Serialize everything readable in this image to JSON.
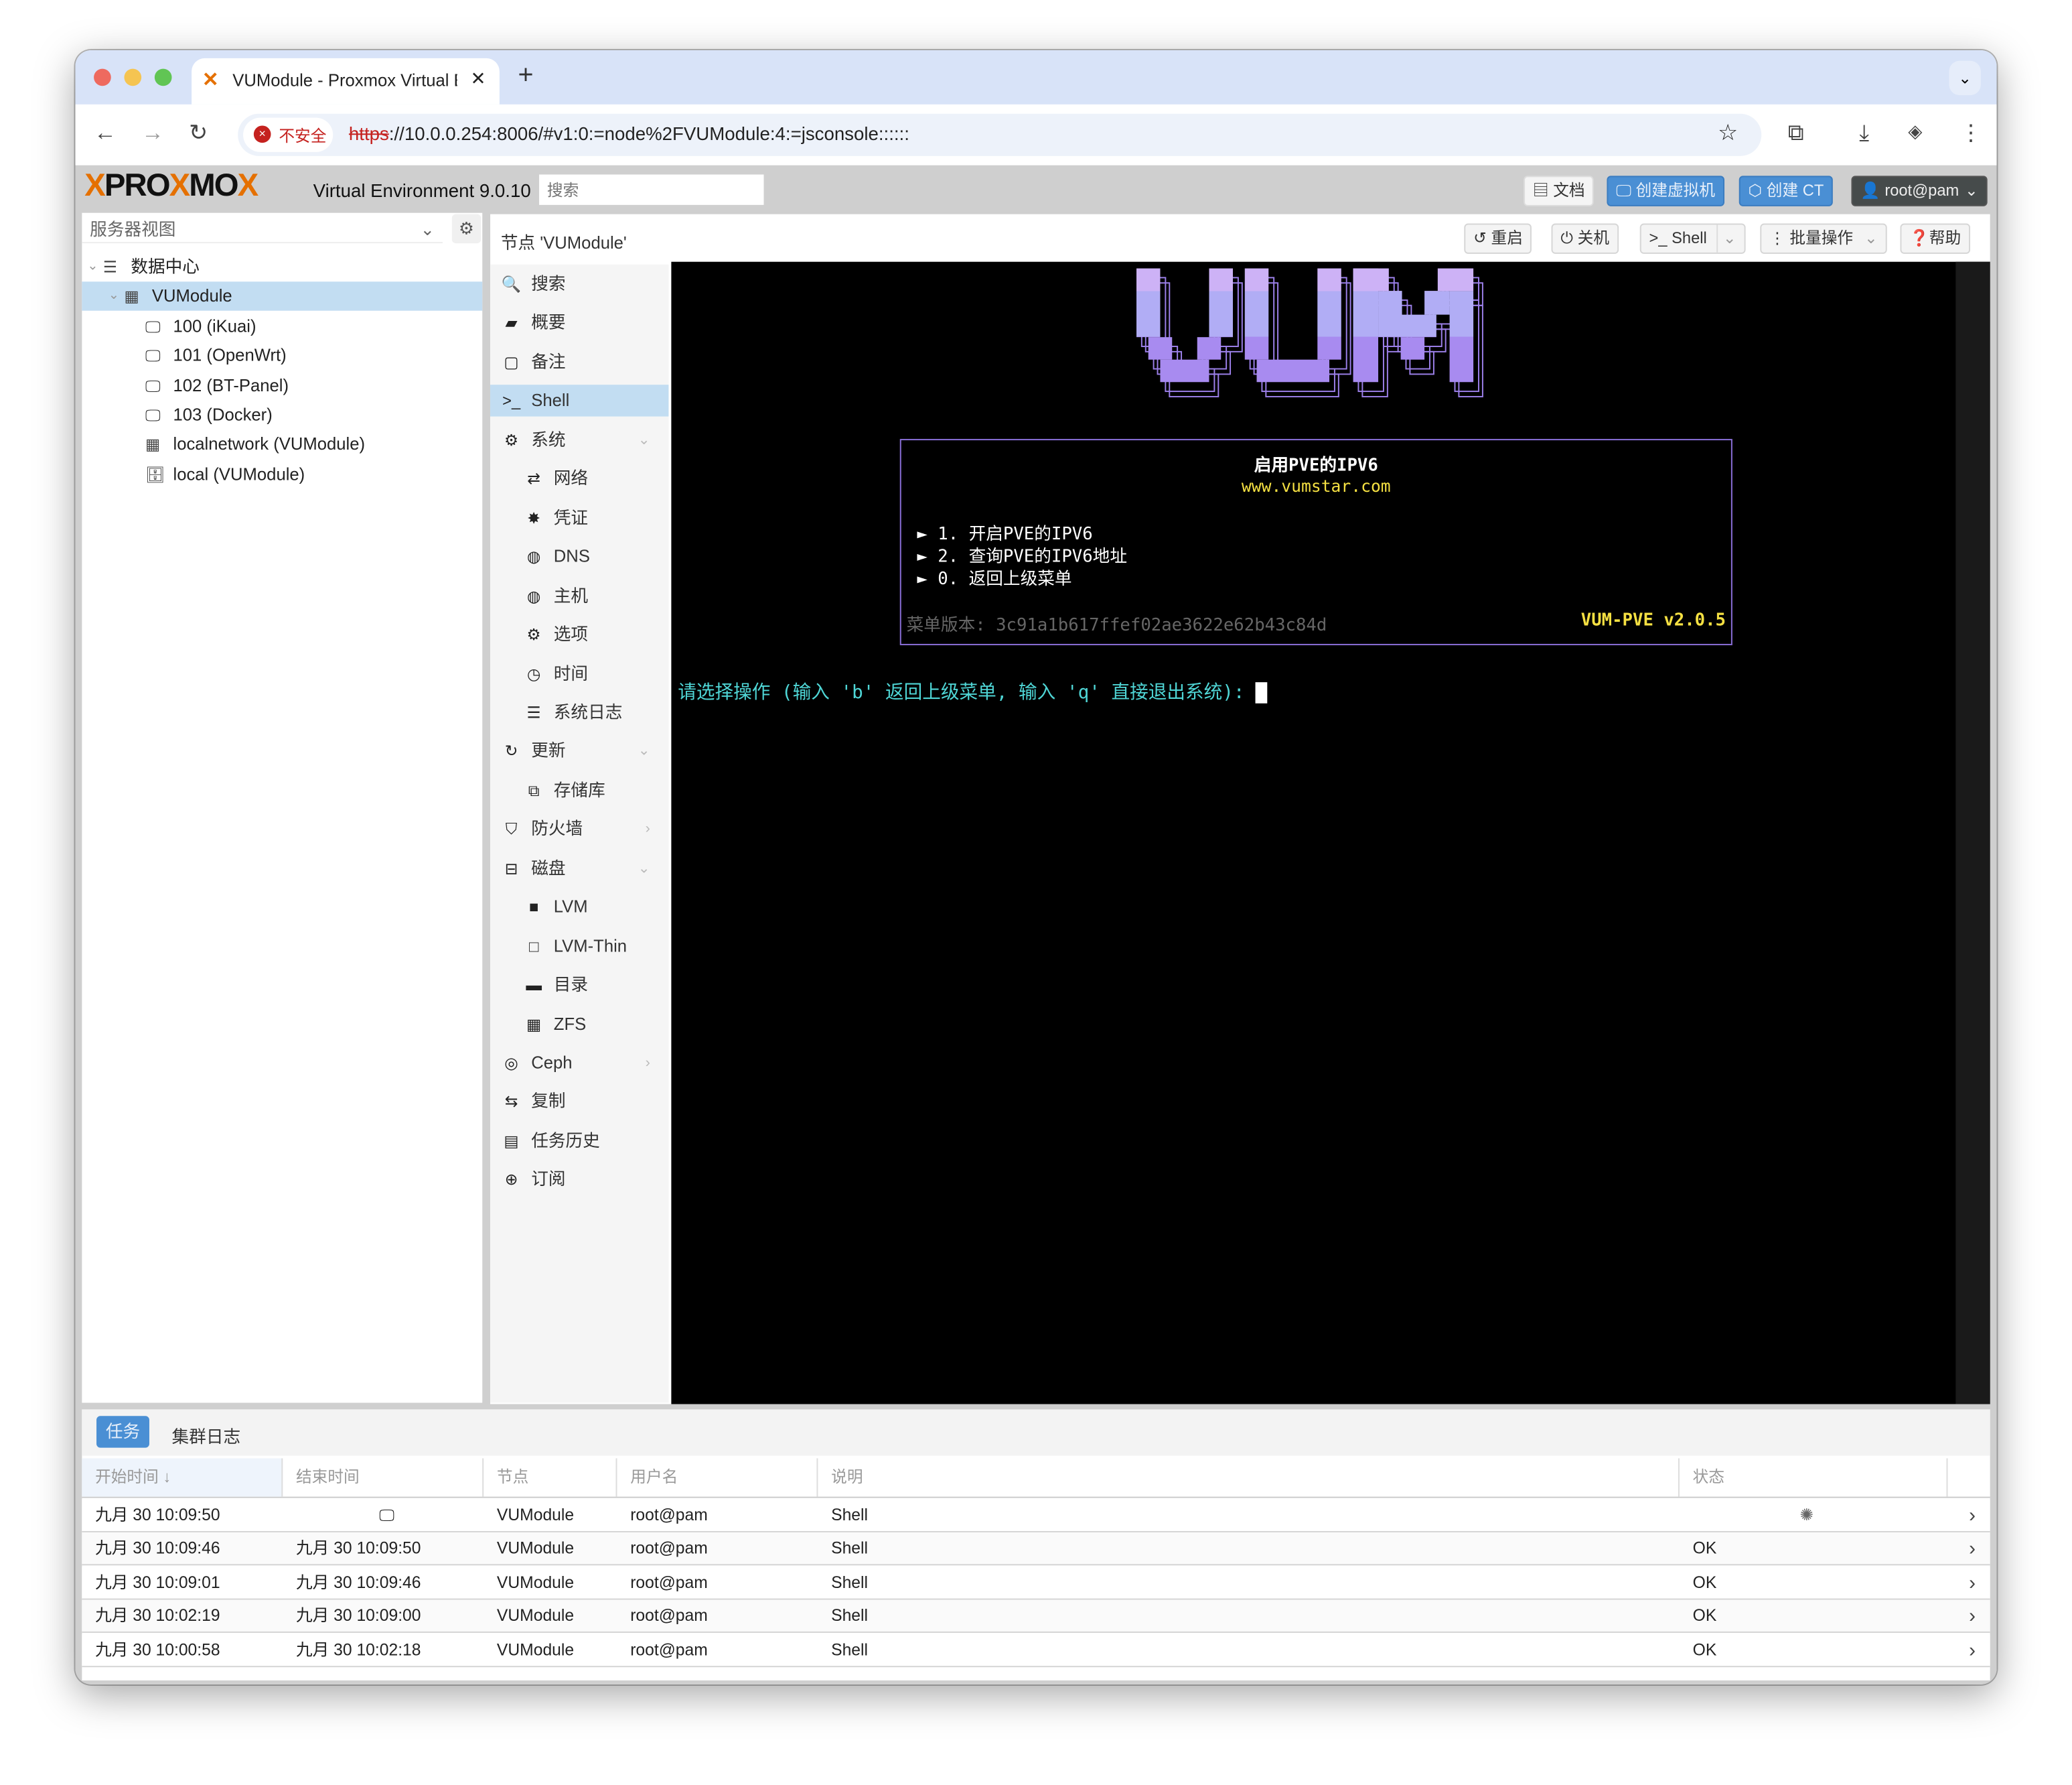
{
  "browser": {
    "tab_title": "VUModule - Proxmox Virtual E",
    "url_scheme": "https",
    "url_rest": "://10.0.0.254:8006/#v1:0:=node%2FVUModule:4:=jsconsole::::::",
    "security_label": "不安全"
  },
  "header": {
    "logo": "PROXMOX",
    "product": "Virtual Environment 9.0.10",
    "search_placeholder": "搜索",
    "docs": "文档",
    "create_vm": "创建虚拟机",
    "create_ct": "创建 CT",
    "user": "root@pam"
  },
  "sidebar": {
    "view": "服务器视图",
    "tree": [
      {
        "label": "数据中心",
        "icon": "datacenter-icon"
      },
      {
        "label": "VUModule",
        "icon": "node-icon"
      },
      {
        "label": "100 (iKuai)",
        "icon": "vm-running-icon"
      },
      {
        "label": "101 (OpenWrt)",
        "icon": "vm-running-icon"
      },
      {
        "label": "102 (BT-Panel)",
        "icon": "vm-running-icon"
      },
      {
        "label": "103 (Docker)",
        "icon": "vm-running-icon"
      },
      {
        "label": "localnetwork (VUModule)",
        "icon": "network-icon"
      },
      {
        "label": "local (VUModule)",
        "icon": "storage-icon"
      }
    ]
  },
  "content": {
    "title": "节点 'VUModule'",
    "buttons": {
      "reboot": "重启",
      "shutdown": "关机",
      "shell": "Shell",
      "bulk": "批量操作",
      "help": "帮助"
    }
  },
  "nav": [
    {
      "label": "搜索",
      "icon": "search-icon"
    },
    {
      "label": "概要",
      "icon": "book-icon"
    },
    {
      "label": "备注",
      "icon": "note-icon"
    },
    {
      "label": "Shell",
      "icon": "terminal-icon"
    },
    {
      "label": "系统",
      "icon": "cogs-icon"
    },
    {
      "label": "网络",
      "icon": "exchange-icon"
    },
    {
      "label": "凭证",
      "icon": "certificate-icon"
    },
    {
      "label": "DNS",
      "icon": "globe-icon"
    },
    {
      "label": "主机",
      "icon": "globe-icon"
    },
    {
      "label": "选项",
      "icon": "gear-icon"
    },
    {
      "label": "时间",
      "icon": "clock-icon"
    },
    {
      "label": "系统日志",
      "icon": "list-icon"
    },
    {
      "label": "更新",
      "icon": "refresh-icon"
    },
    {
      "label": "存储库",
      "icon": "files-icon"
    },
    {
      "label": "防火墙",
      "icon": "shield-icon"
    },
    {
      "label": "磁盘",
      "icon": "hdd-icon"
    },
    {
      "label": "LVM",
      "icon": "square-icon"
    },
    {
      "label": "LVM-Thin",
      "icon": "square-outline-icon"
    },
    {
      "label": "目录",
      "icon": "folder-icon"
    },
    {
      "label": "ZFS",
      "icon": "th-large-icon"
    },
    {
      "label": "Ceph",
      "icon": "ceph-icon"
    },
    {
      "label": "复制",
      "icon": "retweet-icon"
    },
    {
      "label": "任务历史",
      "icon": "list-alt-icon"
    },
    {
      "label": "订阅",
      "icon": "support-icon"
    }
  ],
  "terminal": {
    "logo": "VUM",
    "box_title": "启用PVE的IPV6",
    "site": "www.vumstar.com",
    "items": [
      "► 1. 开启PVE的IPV6",
      "► 2. 查询PVE的IPV6地址",
      "► 0. 返回上级菜单"
    ],
    "menu_version": "菜单版本: 3c91a1b617ffef02ae3622e62b43c84d",
    "app_version": "VUM-PVE v2.0.5",
    "prompt": "请选择操作 (输入 'b' 返回上级菜单, 输入 'q' 直接退出系统):",
    "colors": {
      "border": "#8a6fd8",
      "title": "#ffffff",
      "site": "#f5e042",
      "prompt": "#4fd6d6",
      "version": "#f5e042"
    }
  },
  "log": {
    "tabs": [
      "任务",
      "集群日志"
    ],
    "columns": [
      "开始时间",
      "结束时间",
      "节点",
      "用户名",
      "说明",
      "状态"
    ],
    "rows": [
      {
        "start": "九月 30 10:09:50",
        "end": "",
        "node": "VUModule",
        "user": "root@pam",
        "desc": "Shell",
        "status": ""
      },
      {
        "start": "九月 30 10:09:46",
        "end": "九月 30 10:09:50",
        "node": "VUModule",
        "user": "root@pam",
        "desc": "Shell",
        "status": "OK"
      },
      {
        "start": "九月 30 10:09:01",
        "end": "九月 30 10:09:46",
        "node": "VUModule",
        "user": "root@pam",
        "desc": "Shell",
        "status": "OK"
      },
      {
        "start": "九月 30 10:02:19",
        "end": "九月 30 10:09:00",
        "node": "VUModule",
        "user": "root@pam",
        "desc": "Shell",
        "status": "OK"
      },
      {
        "start": "九月 30 10:00:58",
        "end": "九月 30 10:02:18",
        "node": "VUModule",
        "user": "root@pam",
        "desc": "Shell",
        "status": "OK"
      }
    ]
  }
}
